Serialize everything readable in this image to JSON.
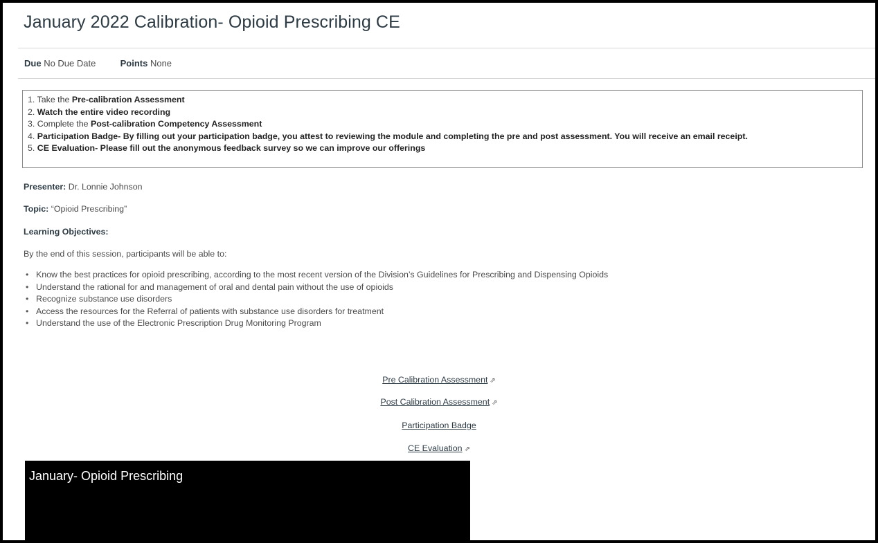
{
  "page": {
    "title": "January 2022 Calibration- Opioid Prescribing CE"
  },
  "meta": {
    "due_label": "Due",
    "due_value": "No Due Date",
    "points_label": "Points",
    "points_value": "None"
  },
  "steps": [
    {
      "num": "1.",
      "pre": "Take the ",
      "bold": "Pre-calibration Assessment",
      "post": ""
    },
    {
      "num": "2.",
      "pre": "",
      "bold": "Watch the entire video recording",
      "post": ""
    },
    {
      "num": "3.",
      "pre": "Complete the ",
      "bold": "Post-calibration Competency Assessment",
      "post": ""
    },
    {
      "num": "4.",
      "pre": "",
      "bold": "Participation Badge- By filling out your participation badge, you attest to reviewing the module and completing the pre and post assessment. You will receive an email receipt.",
      "post": ""
    },
    {
      "num": "5.",
      "pre": "",
      "bold": "CE Evaluation- Please fill out the anonymous feedback survey so we can improve our offerings",
      "post": ""
    }
  ],
  "presenter": {
    "label": "Presenter:",
    "value": "Dr. Lonnie Johnson"
  },
  "topic": {
    "label": "Topic:",
    "value": "“Opioid Prescribing”"
  },
  "objectives": {
    "heading": "Learning Objectives:",
    "intro": "By the end of this session, participants will be able to:",
    "items": [
      "Know the best practices for opioid prescribing, according to the most recent version of the Division’s Guidelines for Prescribing and Dispensing Opioids",
      "Understand the rational for and management of oral and dental pain without the use of opioids",
      "Recognize substance use disorders",
      "Access the resources for the Referral of patients with substance use disorders for treatment",
      "Understand the use of the Electronic Prescription Drug Monitoring Program"
    ]
  },
  "links": [
    {
      "label": "Pre Calibration Assessment",
      "external": true,
      "icon": "external-link-icon"
    },
    {
      "label": "Post Calibration Assessment",
      "external": true,
      "icon": "external-link-icon"
    },
    {
      "label": "Participation Badge",
      "external": false
    },
    {
      "label": "CE Evaluation",
      "external": true,
      "icon": "external-link-icon"
    }
  ],
  "video": {
    "title": "January- Opioid Prescribing"
  }
}
